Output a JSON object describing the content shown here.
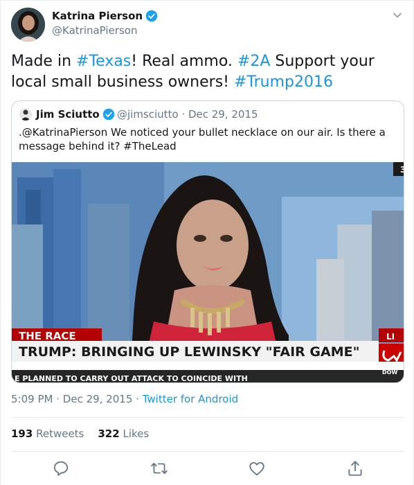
{
  "author": {
    "name": "Katrina Pierson",
    "handle": "@KatrinaPierson"
  },
  "tweet": {
    "seg1": "Made in ",
    "tag1": "#Texas",
    "seg2": "! Real ammo. ",
    "tag2": "#2A",
    "seg3": " Support your local small business owners! ",
    "tag3": "#Trump2016"
  },
  "quoted": {
    "name": "Jim Sciutto",
    "handle": "@jimsciutto",
    "sep": "·",
    "date": "Dec 29, 2015",
    "text": ".@KatrinaPierson We noticed your bullet necklace on our air. Is there a message behind it? #TheLead",
    "media": {
      "banner_top": "THE RACE",
      "headline": "TRUMP: BRINGING UP LEWINSKY \"FAIR GAME\"",
      "ticker": "E PLANNED TO CARRY OUT ATTACK TO COINCIDE WITH",
      "corner_badge": "3",
      "live": "LI",
      "dow": "DOW"
    }
  },
  "timestamp": {
    "time": "5:09 PM",
    "sep1": "·",
    "date": "Dec 29, 2015",
    "sep2": "·",
    "source": "Twitter for Android"
  },
  "stats": {
    "retweets_count": "193",
    "retweets_label": "Retweets",
    "likes_count": "322",
    "likes_label": "Likes"
  },
  "icons": {
    "verified": "verified-badge-icon",
    "menu": "chevron-down-icon",
    "reply": "reply-icon",
    "retweet": "retweet-icon",
    "like": "heart-icon",
    "share": "share-icon"
  },
  "colors": {
    "link": "#1b95e0",
    "verified": "#1da1f2",
    "muted": "#657786",
    "cnn_red": "#cc0000"
  }
}
